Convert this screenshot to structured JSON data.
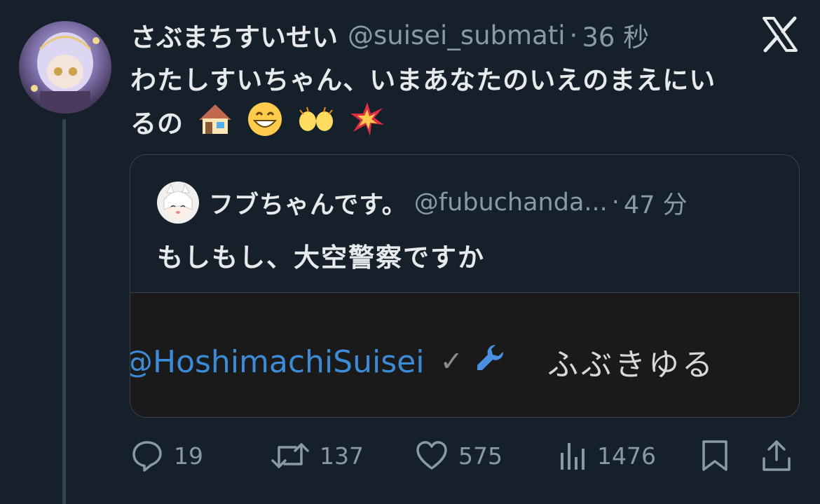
{
  "tweet": {
    "display_name": "さぶまちすいせい",
    "handle": "@suisei_submati",
    "separator": "·",
    "time": "36 秒",
    "text_line1": "わたしすいちゃん、いまあなたのいえのまえにい",
    "text_line2": "るの",
    "emojis": [
      "house-emoji",
      "grinning-emoji",
      "raised-hands-emoji",
      "collision-emoji"
    ]
  },
  "quote": {
    "display_name": "フブちゃんです。",
    "handle": "@fubuchanda...",
    "separator": "·",
    "time": "47 分",
    "text": "もしもし、大空警察ですか",
    "media": {
      "handle_text": "@HoshimachiSuisei",
      "check_text": "✓",
      "jp_text": "ふぶきゆる"
    }
  },
  "actions": {
    "replies": "19",
    "retweets": "137",
    "likes": "575",
    "views": "1476"
  },
  "colors": {
    "background": "#15202b",
    "text": "#e7e9ea",
    "muted": "#8b98a5",
    "border": "#38444d",
    "media_link": "#3d8bd6"
  },
  "icons": [
    "x-logo-icon",
    "reply-icon",
    "retweet-icon",
    "like-icon",
    "views-icon",
    "bookmark-icon",
    "share-icon",
    "wrench-icon"
  ]
}
